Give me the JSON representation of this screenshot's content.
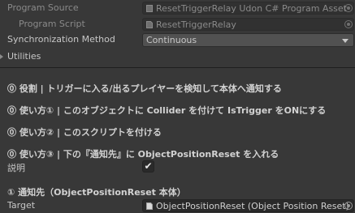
{
  "program_source": {
    "label": "Program Source",
    "value": "ResetTriggerRelay Udon C# Program Asset",
    "icon": "udon-program-asset-icon"
  },
  "program_script": {
    "label": "Program Script",
    "value": "ResetTriggerRelay",
    "icon": "csharp-script-icon"
  },
  "sync_method": {
    "label": "Synchronization Method",
    "value": "Continuous"
  },
  "utilities": {
    "label": "Utilities"
  },
  "headers": [
    "⓪ 役割 | トリガーに入る/出るプレイヤーを検知して本体へ通知する",
    "⓪ 使い方① | このオブジェクトに Collider を付けて IsTrigger をONにする",
    "⓪ 使い方② | このスクリプトを付ける",
    "⓪ 使い方③ | 下の『通知先』に ObjectPositionReset を入れる"
  ],
  "explanation": {
    "label": "説明",
    "checked": true,
    "check_glyph": "✔"
  },
  "target_header": "① 通知先（ObjectPositionReset 本体）",
  "target": {
    "label": "Target",
    "value": "ObjectPositionReset (Object Position Reset)",
    "icon": "udon-behaviour-icon"
  },
  "colors": {
    "background": "#383838",
    "field_bg": "#2a2a2a",
    "dropdown_bg": "#515151",
    "text": "#c8c8c8",
    "disabled_text": "#8a8a8a"
  }
}
